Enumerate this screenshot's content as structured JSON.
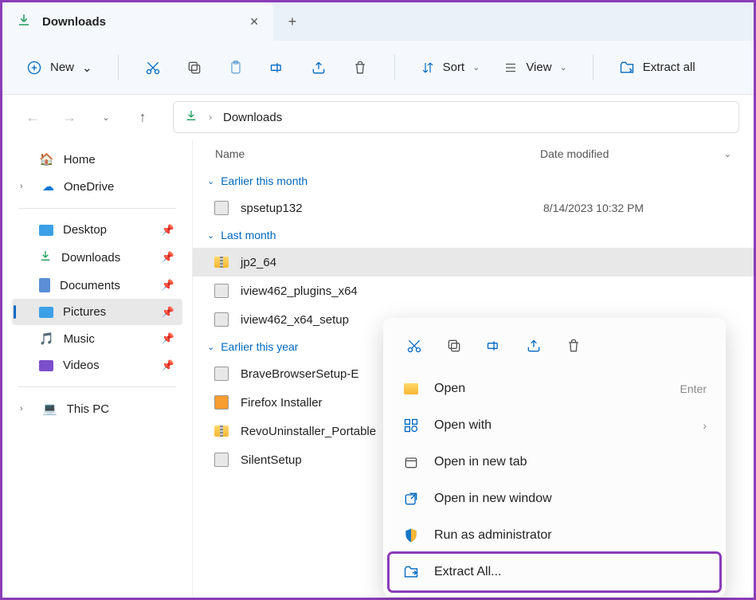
{
  "tab": {
    "title": "Downloads"
  },
  "toolbar": {
    "new_label": "New",
    "sort_label": "Sort",
    "view_label": "View",
    "extract_label": "Extract all"
  },
  "breadcrumb": {
    "current": "Downloads"
  },
  "sidebar": {
    "home": "Home",
    "onedrive": "OneDrive",
    "quick": [
      {
        "label": "Desktop"
      },
      {
        "label": "Downloads"
      },
      {
        "label": "Documents"
      },
      {
        "label": "Pictures"
      },
      {
        "label": "Music"
      },
      {
        "label": "Videos"
      }
    ],
    "thispc": "This PC"
  },
  "columns": {
    "name": "Name",
    "date": "Date modified"
  },
  "groups": [
    {
      "label": "Earlier this month",
      "items": [
        {
          "name": "spsetup132",
          "date": "8/14/2023 10:32 PM",
          "type": "installer"
        }
      ]
    },
    {
      "label": "Last month",
      "items": [
        {
          "name": "jp2_64",
          "date": "",
          "type": "zip",
          "selected": true
        },
        {
          "name": "iview462_plugins_x64",
          "date": "",
          "type": "installer"
        },
        {
          "name": "iview462_x64_setup",
          "date": "",
          "type": "installer"
        }
      ]
    },
    {
      "label": "Earlier this year",
      "items": [
        {
          "name": "BraveBrowserSetup-E",
          "date": "",
          "type": "installer"
        },
        {
          "name": "Firefox Installer",
          "date": "",
          "type": "installer"
        },
        {
          "name": "RevoUninstaller_Portable",
          "date": "",
          "type": "zip"
        },
        {
          "name": "SilentSetup",
          "date": "",
          "type": "installer"
        }
      ]
    }
  ],
  "context_menu": {
    "open": "Open",
    "open_hint": "Enter",
    "open_with": "Open with",
    "open_new_tab": "Open in new tab",
    "open_new_window": "Open in new window",
    "run_admin": "Run as administrator",
    "extract_all": "Extract All..."
  }
}
